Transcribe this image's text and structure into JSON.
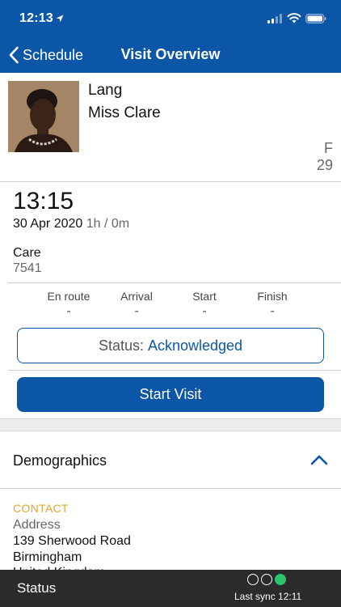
{
  "status_bar": {
    "time": "12:13"
  },
  "nav": {
    "back_label": "Schedule",
    "title": "Visit Overview"
  },
  "patient": {
    "surname": "Lang",
    "name": "Miss Clare",
    "gender": "F",
    "age": "29"
  },
  "visit": {
    "time": "13:15",
    "date": "30 Apr 2020",
    "duration": "1h / 0m",
    "type": "Care",
    "code": "7541",
    "stages": [
      {
        "label": "En route",
        "value": "-"
      },
      {
        "label": "Arrival",
        "value": "-"
      },
      {
        "label": "Start",
        "value": "-"
      },
      {
        "label": "Finish",
        "value": "-"
      }
    ],
    "status_label": "Status:",
    "status_value": "Acknowledged",
    "start_button": "Start Visit"
  },
  "demographics": {
    "title": "Demographics",
    "contact_header": "CONTACT",
    "address_label": "Address",
    "address_lines": [
      "139 Sherwood Road",
      "Birmingham",
      "United Kingdom"
    ]
  },
  "bottom_bar": {
    "status_label": "Status",
    "sync_text": "Last sync 12:11"
  },
  "colors": {
    "primary": "#0c56a8",
    "accent": "#e2a52a",
    "sync_ok": "#2cc36b",
    "footer": "#2b2b2b"
  }
}
